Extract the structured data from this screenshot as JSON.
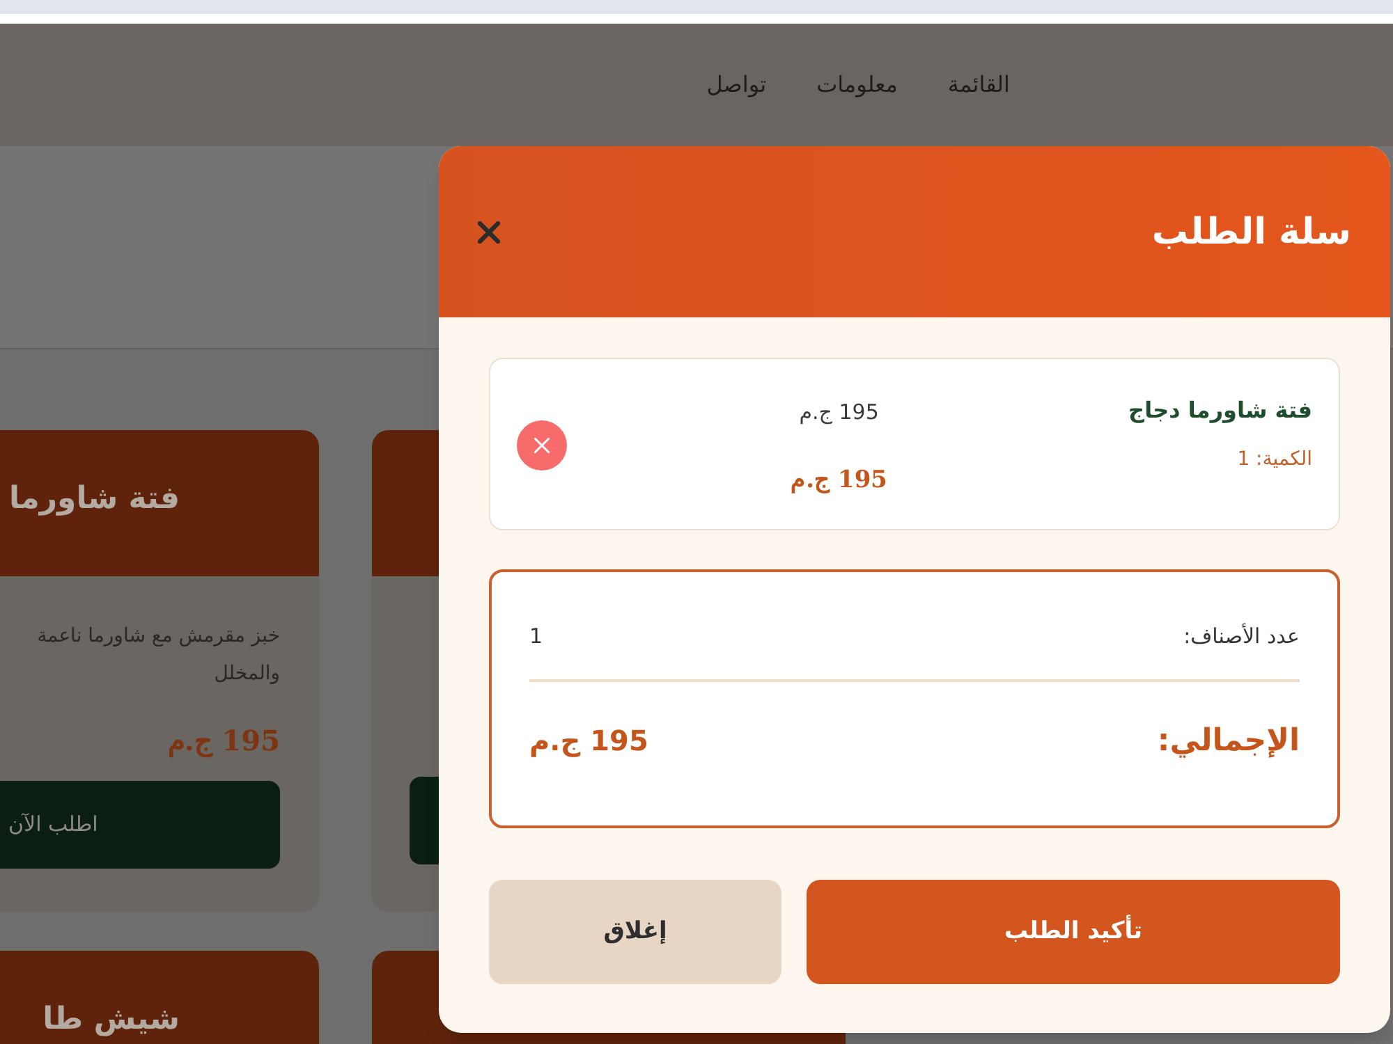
{
  "nav": {
    "links": [
      {
        "label": "القائمة"
      },
      {
        "label": "معلومات"
      },
      {
        "label": "تواصل"
      }
    ]
  },
  "menu_cards": [
    {
      "title": "فتة شاورما",
      "description_lines": [
        "خبز مقرمش مع شاورما ناعمة",
        "والمخلل"
      ],
      "price": "195 ج.م",
      "button": "اطلب الآن"
    },
    {
      "title": "شيش طا"
    }
  ],
  "cart": {
    "title": "سلة الطلب",
    "items": [
      {
        "name": "فتة شاورما دجاج",
        "quantity": "الكمية: 1",
        "unit_price": "195 ج.م",
        "line_total": "195 ج.م"
      }
    ],
    "summary": {
      "count_label": "عدد الأصناف:",
      "count": "1",
      "total_label": "الإجمالي:",
      "total": "195 ج.م"
    },
    "buttons": {
      "confirm": "تأكيد الطلب",
      "close": "إغلاق"
    }
  }
}
